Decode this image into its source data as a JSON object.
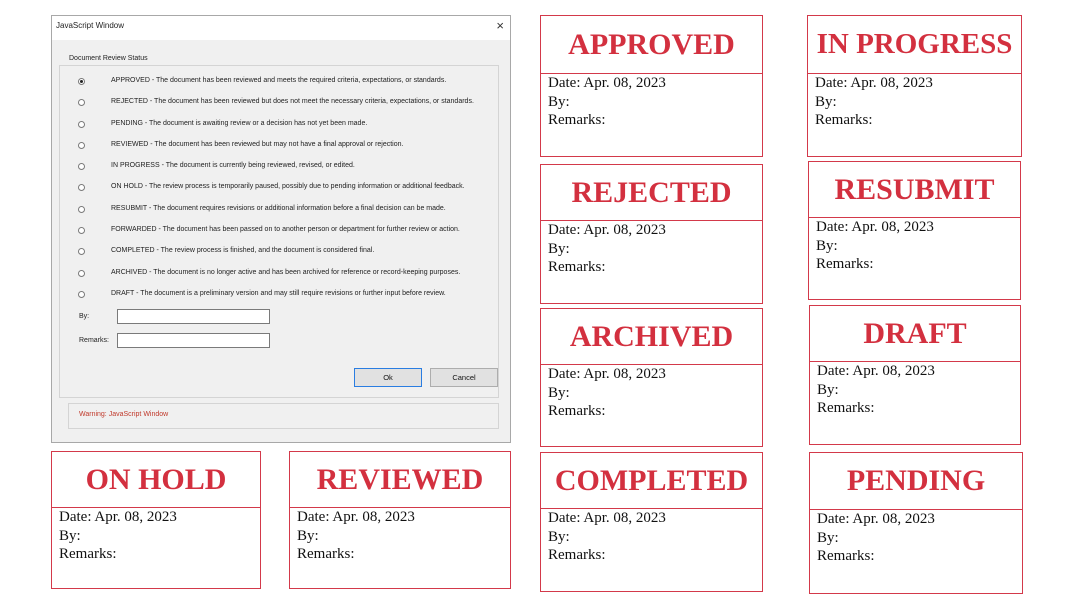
{
  "dialog": {
    "title": "JavaScript Window",
    "close_label": "×",
    "group_label": "Document Review Status",
    "options": [
      {
        "label": "APPROVED - The document has been reviewed and meets the required criteria, expectations, or standards.",
        "selected": true
      },
      {
        "label": "REJECTED - The document has been reviewed but does not meet the necessary criteria, expectations, or standards.",
        "selected": false
      },
      {
        "label": "PENDING - The document is awaiting review or a decision has not yet been made.",
        "selected": false
      },
      {
        "label": "REVIEWED - The document has been reviewed but may not have a final approval or rejection.",
        "selected": false
      },
      {
        "label": "IN PROGRESS - The document is currently being reviewed, revised, or edited.",
        "selected": false
      },
      {
        "label": "ON HOLD - The review process is temporarily paused, possibly due to pending information or additional feedback.",
        "selected": false
      },
      {
        "label": "RESUBMIT - The document requires revisions or additional information before a final decision can be made.",
        "selected": false
      },
      {
        "label": "FORWARDED - The document has been passed on to another person or department for further review or action.",
        "selected": false
      },
      {
        "label": "COMPLETED - The review process is finished, and the document is considered final.",
        "selected": false
      },
      {
        "label": "ARCHIVED - The document is no longer active and has been archived for reference or record-keeping purposes.",
        "selected": false
      },
      {
        "label": "DRAFT - The document is a preliminary version and may still require revisions or further input before review.",
        "selected": false
      }
    ],
    "by_label": "By:",
    "by_value": "",
    "remarks_label": "Remarks:",
    "remarks_value": "",
    "ok_label": "Ok",
    "cancel_label": "Cancel",
    "warning": "Warning: JavaScript Window"
  },
  "stamp_text": {
    "date_line": "Date: Apr. 08, 2023",
    "by_line": "By:",
    "remarks_line": "Remarks:"
  },
  "stamps": {
    "approved": "APPROVED",
    "in_progress": "IN PROGRESS",
    "rejected": "REJECTED",
    "resubmit": "RESUBMIT",
    "archived": "ARCHIVED",
    "draft": "DRAFT",
    "on_hold": "ON HOLD",
    "reviewed": "REVIEWED",
    "completed": "COMPLETED",
    "pending": "PENDING"
  },
  "colors": {
    "stamp_red": "#d3303f",
    "ok_button_border": "#2a7de1",
    "warning_text": "#c0392b"
  }
}
